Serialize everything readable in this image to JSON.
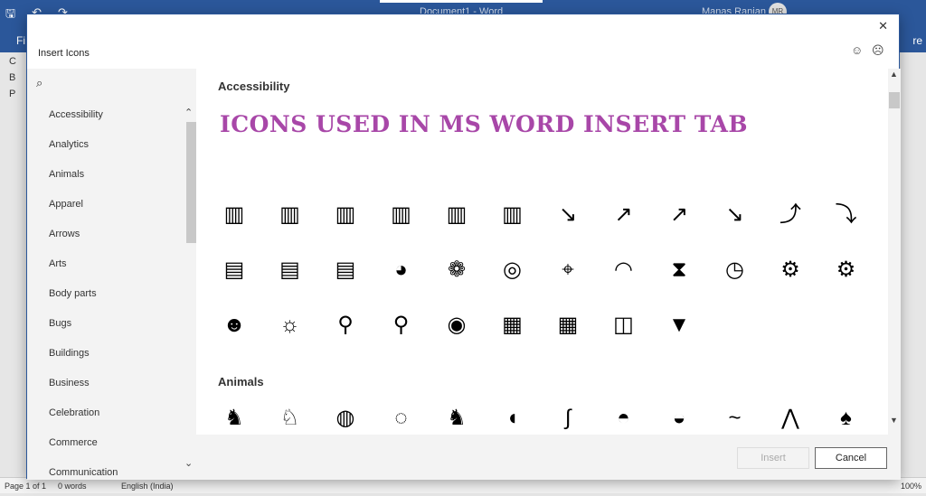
{
  "window": {
    "title": "Document1 - Word",
    "user": "Manas Ranjan",
    "avatar_initials": "MR"
  },
  "ribbon": {
    "file_label": "Fi",
    "share_label": "re"
  },
  "navpane": {
    "items": [
      "C",
      "B",
      "P"
    ]
  },
  "statusbar": {
    "page": "Page 1 of 1",
    "words": "0 words",
    "language": "English (India)",
    "zoom": "100%"
  },
  "dialog": {
    "title": "Insert Icons",
    "close": "✕",
    "feedback_positive": "☺",
    "feedback_negative": "☹",
    "search_icon": "⌕",
    "categories": [
      "Accessibility",
      "Analytics",
      "Animals",
      "Apparel",
      "Arrows",
      "Arts",
      "Body parts",
      "Bugs",
      "Buildings",
      "Business",
      "Celebration",
      "Commerce",
      "Communication"
    ],
    "overlay_text": "ICONS USED IN MS WORD INSERT TAB",
    "sections": [
      {
        "heading": "Accessibility",
        "icons": [
          "bar-chart",
          "bar-chart-rising",
          "bar-chart-falling",
          "bar-chart-up",
          "bar-chart-box",
          "bar-chart-down",
          "line-chart-down",
          "line-chart-up",
          "line-chart-trend",
          "line-chart-falling",
          "scatter-line",
          "scatter-down",
          "presentation-chart",
          "presentation-bars",
          "presentation-pie",
          "pie-chart",
          "venn-diagram",
          "target",
          "crosshair",
          "speedometer",
          "hourglass",
          "stopwatch",
          "gear",
          "gears",
          "head-gears",
          "lightbulb",
          "magnifier",
          "magnifier-pulse",
          "eye",
          "tactics-board",
          "table",
          "database",
          "funnel"
        ]
      },
      {
        "heading": "Animals",
        "icons": [
          "cat",
          "dog",
          "fish-bowl",
          "hamster-ball",
          "rabbit",
          "mouse",
          "snake",
          "turtle",
          "frog",
          "lizard",
          "bats",
          "bird"
        ]
      }
    ],
    "insert_label": "Insert",
    "cancel_label": "Cancel"
  }
}
